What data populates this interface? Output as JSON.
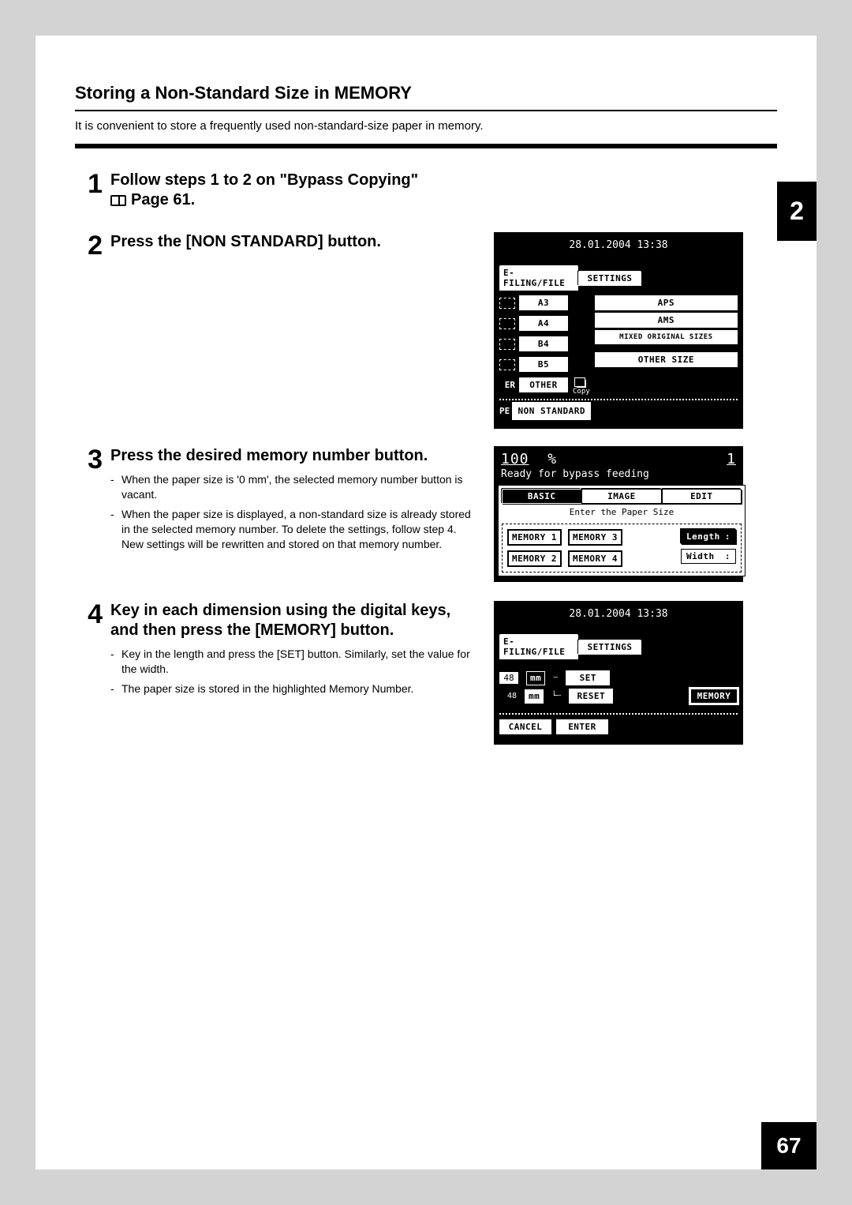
{
  "section_title": "Storing a Non-Standard Size in MEMORY",
  "intro": "It is convenient to store a frequently used non-standard-size paper in memory.",
  "chapter_tab": "2",
  "page_number": "67",
  "steps": {
    "s1": {
      "num": "1",
      "heading_a": "Follow steps 1 to 2 on \"Bypass Copying\"",
      "heading_b": "Page 61."
    },
    "s2": {
      "num": "2",
      "heading": "Press the [NON STANDARD] button.",
      "lcd": {
        "date": "28.01.2004 13:38",
        "tab_efiling": "E-FILING/FILE",
        "tab_settings": "SETTINGS",
        "size_a3": "A3",
        "size_a4": "A4",
        "size_b4": "B4",
        "size_b5": "B5",
        "other": "OTHER",
        "aps": "APS",
        "ams": "AMS",
        "mixed": "MIXED ORIGINAL SIZES",
        "other_size": "OTHER SIZE",
        "copy": "Copy",
        "er": "ER",
        "pe": "PE",
        "non_standard": "NON STANDARD"
      }
    },
    "s3": {
      "num": "3",
      "heading": "Press the desired memory number button.",
      "note1": "When the paper size is '0 mm', the selected memory number button is vacant.",
      "note2": "When the paper size is displayed, a non-standard size is already stored in the selected memory number. To delete the settings, follow step 4. New settings will be rewritten and stored on that memory number.",
      "lcd": {
        "zoom": "100",
        "pct": "%",
        "count": "1",
        "ready": "Ready for bypass feeding",
        "tab_basic": "BASIC",
        "tab_image": "IMAGE",
        "tab_edit": "EDIT",
        "subhead": "Enter the Paper Size",
        "mem1": "MEMORY 1",
        "mem2": "MEMORY 2",
        "mem3": "MEMORY 3",
        "mem4": "MEMORY 4",
        "length": "Length",
        "width": "Width",
        "colon": ":"
      }
    },
    "s4": {
      "num": "4",
      "heading": "Key in each dimension using the digital keys, and then press the [MEMORY] button.",
      "note1": "Key in the length and press the [SET] button. Similarly, set the value for the width.",
      "note2": "The paper size is stored in the highlighted Memory Number.",
      "lcd": {
        "date": "28.01.2004 13:38",
        "tab_efiling": "E-FILING/FILE",
        "tab_settings": "SETTINGS",
        "val1": "48",
        "mm": "mm",
        "set": "SET",
        "val2": "48",
        "reset": "RESET",
        "memory": "MEMORY",
        "cancel": "CANCEL",
        "enter": "ENTER"
      }
    }
  }
}
